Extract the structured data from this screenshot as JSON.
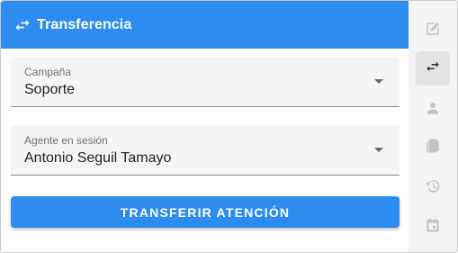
{
  "header": {
    "icon": "swap-arrows-icon",
    "title": "Transferencia"
  },
  "form": {
    "campaign": {
      "label": "Campaña",
      "value": "Soporte"
    },
    "agent": {
      "label": "Agente en sesión",
      "value": "Antonio Seguil Tamayo"
    },
    "submit_label": "TRANSFERIR ATENCIÓN"
  },
  "rail": {
    "items": [
      {
        "icon": "edit-square-icon",
        "active": false
      },
      {
        "icon": "swap-arrows-icon",
        "active": true
      },
      {
        "icon": "person-icon",
        "active": false
      },
      {
        "icon": "documents-icon",
        "active": false
      },
      {
        "icon": "history-icon",
        "active": false
      },
      {
        "icon": "calendar-icon",
        "active": false
      }
    ]
  },
  "colors": {
    "primary": "#2d8cf0",
    "field_bg": "#f5f5f5",
    "rail_bg": "#f4f4f4",
    "rail_active": "#e3e3e3",
    "rail_icon": "#c4c4c4"
  }
}
